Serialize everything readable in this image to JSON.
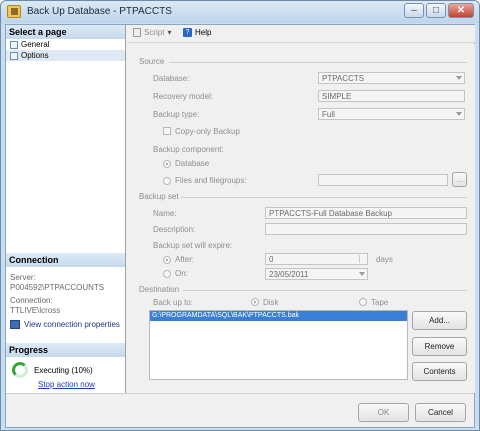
{
  "window": {
    "title": "Back Up Database - PTPACCTS"
  },
  "left": {
    "select_header": "Select a page",
    "pages": [
      {
        "label": "General"
      },
      {
        "label": "Options"
      }
    ],
    "connection": {
      "header": "Connection",
      "server_label": "Server:",
      "server_value": "P004592\\PTPACCOUNTS",
      "conn_label": "Connection:",
      "conn_value": "TTLIVE\\lcross",
      "link": "View connection properties"
    },
    "progress": {
      "header": "Progress",
      "status": "Executing (10%)",
      "link": "Stop action now",
      "percent": 10
    }
  },
  "toolbar": {
    "script": "Script",
    "help": "Help"
  },
  "source": {
    "group": "Source",
    "database_label": "Database:",
    "database_value": "PTPACCTS",
    "recovery_label": "Recovery model:",
    "recovery_value": "SIMPLE",
    "backup_type_label": "Backup type:",
    "backup_type_value": "Full",
    "copy_only": "Copy-only Backup",
    "component_label": "Backup component:",
    "opt_database": "Database",
    "opt_files": "Files and filegroups:",
    "browse": "..."
  },
  "backupset": {
    "group": "Backup set",
    "name_label": "Name:",
    "name_value": "PTPACCTS-Full Database Backup",
    "desc_label": "Description:",
    "desc_value": "",
    "expire_label": "Backup set will expire:",
    "after_label": "After:",
    "after_value": "0",
    "days": "days",
    "on_label": "On:",
    "on_value": "23/05/2011"
  },
  "destination": {
    "group": "Destination",
    "backup_to": "Back up to:",
    "disk": "Disk",
    "tape": "Tape",
    "path": "G:\\PROGRAMDATA\\SQL\\BAK\\PTPACCTS.bak",
    "add": "Add...",
    "remove": "Remove",
    "contents": "Contents"
  },
  "footer": {
    "ok": "OK",
    "cancel": "Cancel"
  }
}
